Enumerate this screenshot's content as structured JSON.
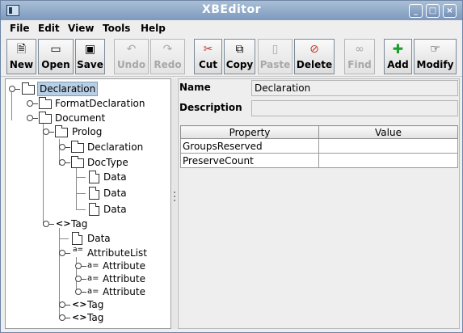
{
  "window": {
    "title": "XBEditor",
    "minimize": "_",
    "maximize": "□",
    "close": "×"
  },
  "menu": [
    "File",
    "Edit",
    "View",
    "Tools",
    "Help"
  ],
  "toolbar": [
    {
      "label": "New",
      "icon": "new-document-icon",
      "enabled": true
    },
    {
      "label": "Open",
      "icon": "open-folder-icon",
      "enabled": true
    },
    {
      "label": "Save",
      "icon": "floppy-disk-icon",
      "enabled": true
    },
    {
      "label": "Undo",
      "icon": "undo-icon",
      "enabled": false
    },
    {
      "label": "Redo",
      "icon": "redo-icon",
      "enabled": false
    },
    {
      "label": "Cut",
      "icon": "scissors-icon",
      "enabled": true
    },
    {
      "label": "Copy",
      "icon": "copy-icon",
      "enabled": true
    },
    {
      "label": "Paste",
      "icon": "clipboard-icon",
      "enabled": false
    },
    {
      "label": "Delete",
      "icon": "delete-icon",
      "enabled": true
    },
    {
      "label": "Find",
      "icon": "binoculars-icon",
      "enabled": false
    },
    {
      "label": "Add",
      "icon": "plus-icon",
      "enabled": true
    },
    {
      "label": "Modify",
      "icon": "pointing-hand-icon",
      "enabled": true
    }
  ],
  "tree": [
    {
      "label": "Declaration",
      "type": "folder",
      "depth": 0,
      "selected": true
    },
    {
      "label": "FormatDeclaration",
      "type": "folder",
      "depth": 1
    },
    {
      "label": "Document",
      "type": "folder",
      "depth": 1
    },
    {
      "label": "Prolog",
      "type": "folder",
      "depth": 2
    },
    {
      "label": "Declaration",
      "type": "folder",
      "depth": 3
    },
    {
      "label": "DocType",
      "type": "folder",
      "depth": 3
    },
    {
      "label": "Data",
      "type": "page",
      "depth": 4
    },
    {
      "label": "Data",
      "type": "page",
      "depth": 4
    },
    {
      "label": "Data",
      "type": "page",
      "depth": 4
    },
    {
      "label": "Tag",
      "type": "tag",
      "glyph": "<>",
      "depth": 2
    },
    {
      "label": "Data",
      "type": "page",
      "depth": 3
    },
    {
      "label": "AttributeList",
      "type": "list",
      "glyph": "a=",
      "depth": 3
    },
    {
      "label": "Attribute",
      "type": "attr",
      "glyph": "a=",
      "depth": 4
    },
    {
      "label": "Attribute",
      "type": "attr",
      "glyph": "a=",
      "depth": 4
    },
    {
      "label": "Attribute",
      "type": "attr",
      "glyph": "a=",
      "depth": 4
    },
    {
      "label": "Tag",
      "type": "tag",
      "glyph": "<>",
      "depth": 3
    },
    {
      "label": "Tag",
      "type": "tag",
      "glyph": "<>",
      "depth": 3
    }
  ],
  "details": {
    "name_label": "Name",
    "name_value": "Declaration",
    "description_label": "Description",
    "description_value": ""
  },
  "properties": {
    "columns": [
      "Property",
      "Value"
    ],
    "rows": [
      [
        "GroupsReserved",
        ""
      ],
      [
        "PreserveCount",
        ""
      ]
    ]
  }
}
